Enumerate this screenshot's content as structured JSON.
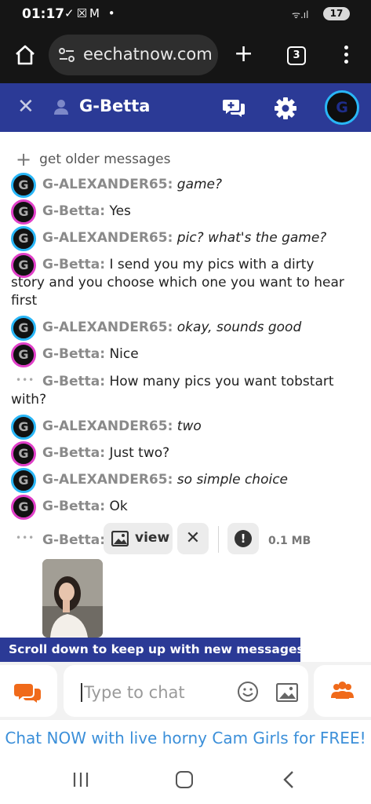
{
  "status_bar": {
    "time": "01:17",
    "left_icons": "✓☒M •",
    "signal": "ᯤ.ıl",
    "battery": "17"
  },
  "browser": {
    "url": "eechatnow.com",
    "tab_count": "3"
  },
  "header": {
    "title": "G-Betta"
  },
  "my_avatar_letter": "G",
  "older_messages": "get older messages",
  "messages": [
    {
      "user": "G-ALEXANDER65:",
      "text": "game?",
      "italic": true,
      "avatar": "blue"
    },
    {
      "user": "G-Betta:",
      "text": "Yes",
      "italic": false,
      "avatar": "pink"
    },
    {
      "user": "G-ALEXANDER65:",
      "text": "pic? what's the game?",
      "italic": true,
      "avatar": "blue"
    },
    {
      "user": "G-Betta:",
      "text": "I send you my pics with a dirty story and you choose which one you want to hear first",
      "italic": false,
      "avatar": "pink"
    },
    {
      "user": "G-ALEXANDER65:",
      "text": "okay, sounds good",
      "italic": true,
      "avatar": "blue"
    },
    {
      "user": "G-Betta:",
      "text": "Nice",
      "italic": false,
      "avatar": "pink"
    },
    {
      "user": "G-Betta:",
      "text": "How many pics you want tobstart with?",
      "italic": false,
      "avatar": "dots"
    },
    {
      "user": "G-ALEXANDER65:",
      "text": "two",
      "italic": true,
      "avatar": "blue"
    },
    {
      "user": "G-Betta:",
      "text": "Just two?",
      "italic": false,
      "avatar": "pink"
    },
    {
      "user": "G-ALEXANDER65:",
      "text": "so simple choice",
      "italic": true,
      "avatar": "blue"
    },
    {
      "user": "G-Betta:",
      "text": "Ok",
      "italic": false,
      "avatar": "pink"
    }
  ],
  "attachment": {
    "user": "G-Betta:",
    "view_label": "view",
    "size": "0.1 MB"
  },
  "scroll_banner": "Scroll down to keep up with new messages",
  "input": {
    "placeholder": "Type to chat"
  },
  "promo": "Chat NOW with live horny Cam Girls for FREE!",
  "colors": {
    "header_bg": "#2b3a96",
    "accent_orange": "#f06a1a",
    "promo_blue": "#3b8fd9",
    "avatar_blue": "#29b6f6",
    "avatar_pink": "#e040c8"
  }
}
